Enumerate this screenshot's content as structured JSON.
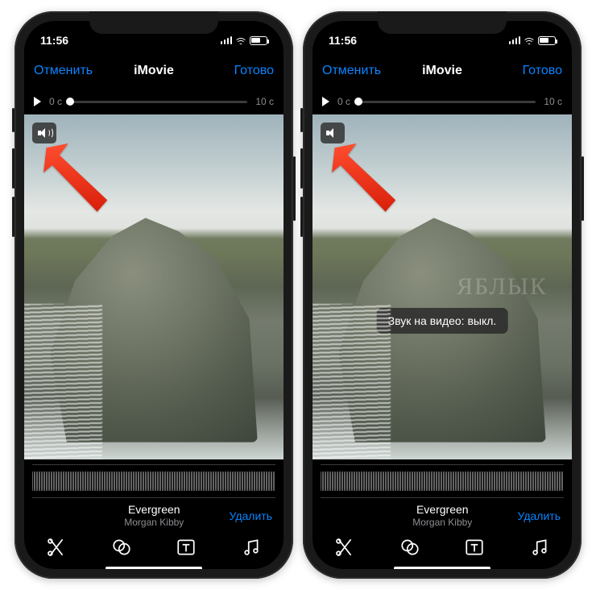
{
  "status": {
    "time": "11:56"
  },
  "nav": {
    "cancel": "Отменить",
    "title": "iMovie",
    "done": "Готово"
  },
  "timeline": {
    "start": "0 c",
    "end": "10 c"
  },
  "sound": {
    "on_name": "speaker-on-icon",
    "off_name": "speaker-off-icon"
  },
  "toast": {
    "sound_off": "Звук на видео: выкл."
  },
  "song": {
    "title": "Evergreen",
    "artist": "Morgan Kibby",
    "delete": "Удалить"
  },
  "watermark": "ЯБЛЫК"
}
